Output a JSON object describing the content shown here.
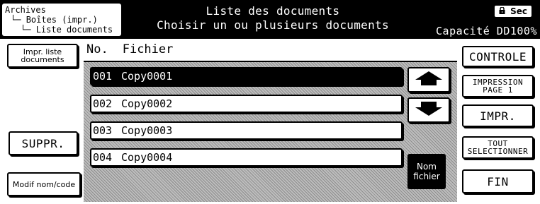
{
  "header": {
    "breadcrumb": [
      "Archives",
      "Boîtes (impr.)",
      "Liste documents"
    ],
    "title_line1": "Liste des documents",
    "title_line2": "Choisir un ou plusieurs documents",
    "security_label": "Sec",
    "capacity": "Capacité DD100%"
  },
  "left_buttons": {
    "print_list": [
      "Impr. liste",
      "documents"
    ],
    "delete": "SUPPR.",
    "modify": "Modif nom/code"
  },
  "list": {
    "columns": [
      "No.",
      "Fichier"
    ],
    "rows": [
      {
        "no": "001",
        "name": "Copy0001",
        "selected": true
      },
      {
        "no": "002",
        "name": "Copy0002",
        "selected": false
      },
      {
        "no": "003",
        "name": "Copy0003",
        "selected": false
      },
      {
        "no": "004",
        "name": "Copy0004",
        "selected": false
      }
    ],
    "name_button": [
      "Nom",
      "fichier"
    ]
  },
  "right_buttons": {
    "check": "CONTROLE",
    "print_page1": [
      "IMPRESSION",
      "PAGE 1"
    ],
    "print": "IMPR.",
    "select_all": [
      "TOUT",
      "SELECTIONNER"
    ],
    "end": "FIN"
  },
  "icons": {
    "scroll_up": "arrow-up-icon",
    "scroll_down": "arrow-down-icon",
    "lock": "lock-icon"
  },
  "colors": {
    "header_bg": "#000000",
    "selected_row_bg": "#000000",
    "panel_pattern": "#bdbdbd"
  }
}
